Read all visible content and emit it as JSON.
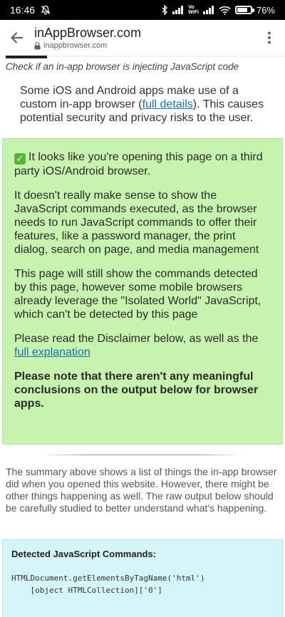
{
  "status_bar": {
    "time": "16:46",
    "battery_percent": "76%",
    "battery_level": 0.76,
    "volte_top": "Vo",
    "volte_bottom": "WiFi"
  },
  "toolbar": {
    "title": "inAppBrowser.com",
    "url": "inappbrowser.com"
  },
  "page": {
    "subtitle": "Check if an in-app browser is injecting JavaScript code",
    "intro_before": "Some iOS and Android apps make use of a custom in-app browser (",
    "intro_link": "full details",
    "intro_after": "). This causes potential security and privacy risks to the user.",
    "notice": {
      "p1": "It looks like you're opening this page on a third party iOS/Android browser.",
      "p2": "It doesn't really make sense to show the JavaScript commands executed, as the browser needs to run JavaScript commands to offer their features, like a password manager, the print dialog, search on page, and media management",
      "p3": "This page will still show the commands detected by this page, however some mobile browsers already leverage the \"Isolated World\" JavaScript, which can't be detected by this page",
      "p4_before": "Please read the Disclaimer below, as well as the ",
      "p4_link": "full explanation",
      "p5": "Please note that there aren't any meaningful conclusions on the output below for browser apps."
    },
    "summary": "The summary above shows a list of things the in-app browser did when you opened this website. However, there might be other things happening as well. The raw output below should be carefully studied to better understand what's happening.",
    "detected": {
      "title": "Detected JavaScript Commands:",
      "line1": "HTMLDocument.getElementsByTagName('html')",
      "line2": "    [object HTMLCollection]['0']"
    }
  }
}
